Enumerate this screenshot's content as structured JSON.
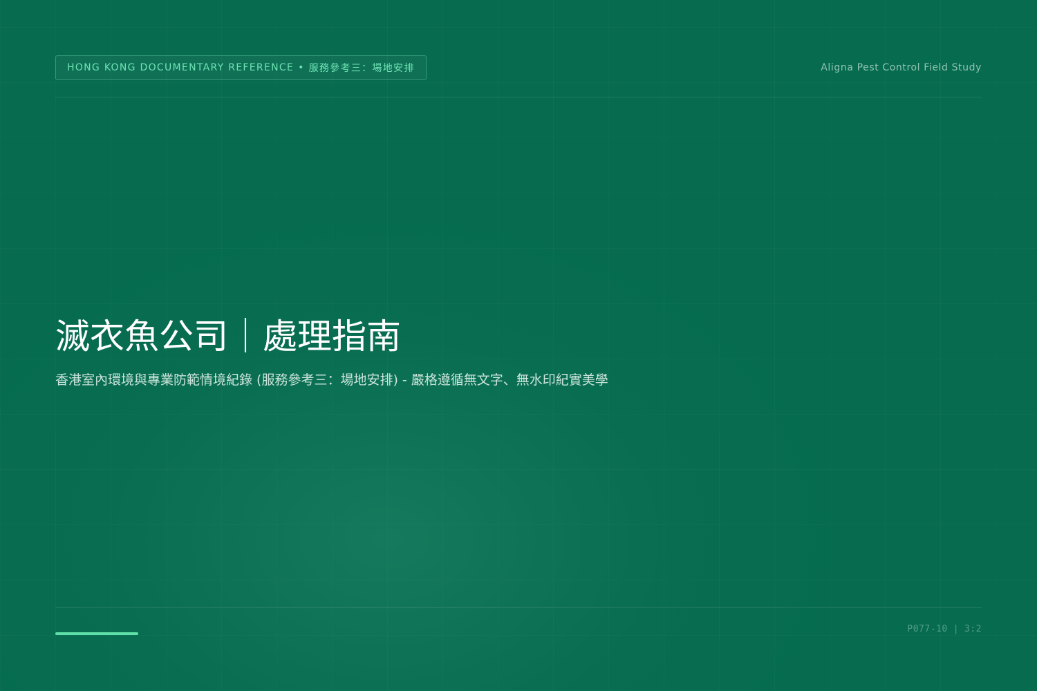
{
  "header": {
    "badge_prefix": "HONG KONG DOCUMENTARY REFERENCE",
    "badge_separator": "•",
    "badge_suffix": "服務參考三：場地安排",
    "study_label": "Aligna Pest Control Field Study"
  },
  "main": {
    "title": "滅衣魚公司｜處理指南",
    "subtitle": "香港室內環境與專業防範情境紀錄 (服務參考三：場地安排) - 嚴格遵循無文字、無水印紀實美學"
  },
  "footer": {
    "code": "P077-10",
    "divider": "|",
    "ratio": "3:2"
  },
  "colors": {
    "background": "#066b4f",
    "accent": "#5fe0a8",
    "badge_text": "#6fe3b4",
    "title_text": "#ffffff"
  }
}
